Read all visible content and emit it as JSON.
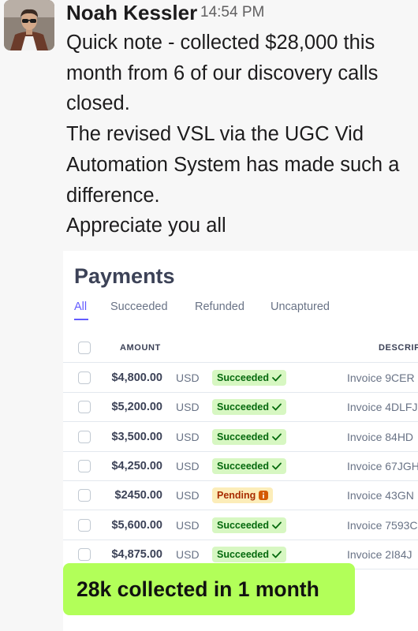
{
  "message": {
    "author": "Noah Kessler",
    "timestamp": "14:54 PM",
    "lines": [
      "Quick note - collected $28,000 this",
      "month from 6 of our discovery calls",
      "closed.",
      "The revised VSL via the UGC Vid",
      "Automation System has made such a",
      "difference.",
      "Appreciate you all"
    ]
  },
  "payments": {
    "title": "Payments",
    "tabs": [
      "All",
      "Succeeded",
      "Refunded",
      "Uncaptured"
    ],
    "active_tab": "All",
    "columns": {
      "amount": "AMOUNT",
      "description": "DESCRIP"
    },
    "rows": [
      {
        "amount": "$4,800.00",
        "currency": "USD",
        "status": "Succeeded",
        "status_icon": "check-icon",
        "description": "Invoice 9CER"
      },
      {
        "amount": "$5,200.00",
        "currency": "USD",
        "status": "Succeeded",
        "status_icon": "check-icon",
        "description": "Invoice 4DLFJ"
      },
      {
        "amount": "$3,500.00",
        "currency": "USD",
        "status": "Succeeded",
        "status_icon": "check-icon",
        "description": "Invoice 84HD"
      },
      {
        "amount": "$4,250.00",
        "currency": "USD",
        "status": "Succeeded",
        "status_icon": "check-icon",
        "description": "Invoice 67JGH"
      },
      {
        "amount": "$2450.00",
        "currency": "USD",
        "status": "Pending",
        "status_icon": "info-icon",
        "description": "Invoice 43GN"
      },
      {
        "amount": "$5,600.00",
        "currency": "USD",
        "status": "Succeeded",
        "status_icon": "check-icon",
        "description": "Invoice 7593C"
      },
      {
        "amount": "$4,875.00",
        "currency": "USD",
        "status": "Succeeded",
        "status_icon": "check-icon",
        "description": "Invoice 2I84J"
      }
    ]
  },
  "highlight": {
    "text": "28k collected in 1 month"
  },
  "colors": {
    "accent": "#635bff",
    "succeeded_bg": "#d7f7c2",
    "succeeded_text": "#05690d",
    "pending_bg": "#fcedb9",
    "pending_text": "#a82c00",
    "highlight_bg": "#b2ff59"
  }
}
